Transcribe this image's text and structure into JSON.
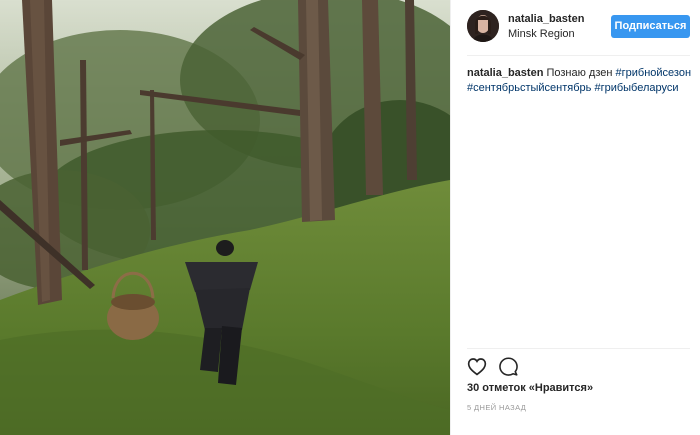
{
  "post": {
    "username": "natalia_basten",
    "location": "Minsk Region",
    "follow_label": "Подписаться",
    "caption_text": "Познаю дзен",
    "hashtags": [
      "#грибнойсезон",
      "#сентябрьстыйсентябрь",
      "#грибыбеларуси"
    ],
    "likes_text": "30 отметок «Нравится»",
    "time_text": "5 ДНЕЙ НАЗАД"
  },
  "icons": {
    "like": "heart-icon",
    "comment": "comment-icon"
  },
  "colors": {
    "follow_button": "#3897f0",
    "hashtag": "#003569",
    "muted": "#999999"
  }
}
